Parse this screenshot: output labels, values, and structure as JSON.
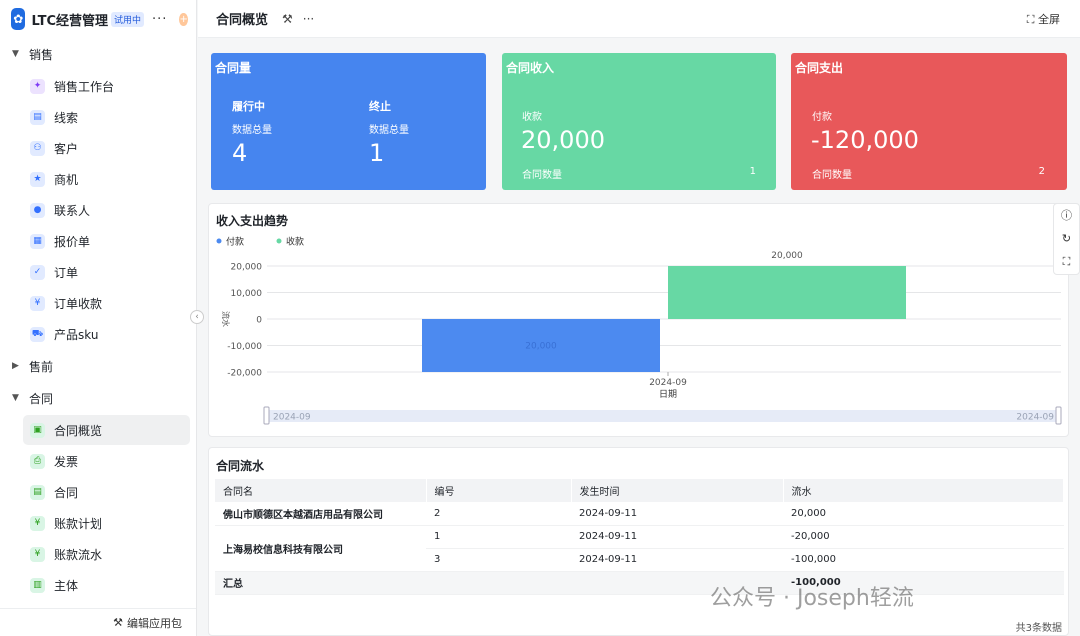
{
  "app": {
    "name": "LTC经营管理",
    "trial_badge": "试用中",
    "more": "···",
    "footer_label": "编辑应用包"
  },
  "sidebar": {
    "groups": [
      {
        "label": "销售",
        "expanded": true
      },
      {
        "label": "售前",
        "expanded": false
      },
      {
        "label": "合同",
        "expanded": true
      }
    ],
    "sales_items": [
      "销售工作台",
      "线索",
      "客户",
      "商机",
      "联系人",
      "报价单",
      "订单",
      "订单收款",
      "产品sku"
    ],
    "contract_items": [
      "合同概览",
      "发票",
      "合同",
      "账款计划",
      "账款流水",
      "主体"
    ],
    "active": "合同概览"
  },
  "topbar": {
    "title": "合同概览",
    "fullscreen": "全屏"
  },
  "cards": {
    "contracts": {
      "title": "合同量",
      "col1_label": "履行中",
      "col1_sub": "数据总量",
      "col1_value": "4",
      "col2_label": "终止",
      "col2_sub": "数据总量",
      "col2_value": "1",
      "color": "#4685ef"
    },
    "income": {
      "title": "合同收入",
      "label": "收款",
      "value": "20,000",
      "count_label": "合同数量",
      "count": "1",
      "color": "#67d8a4"
    },
    "expense": {
      "title": "合同支出",
      "label": "付款",
      "value": "-120,000",
      "count_label": "合同数量",
      "count": "2",
      "color": "#e8585a"
    }
  },
  "chart_panel": {
    "title": "收入支出趋势"
  },
  "chart_data": {
    "type": "bar",
    "categories": [
      "2024-09"
    ],
    "series": [
      {
        "name": "付款",
        "values": [
          -20000
        ],
        "label": "20,000",
        "color": "#4c8af0"
      },
      {
        "name": "收款",
        "values": [
          20000
        ],
        "label": "20,000",
        "color": "#67d8a4"
      }
    ],
    "xlabel": "日期",
    "ylabel": "流水",
    "ylim": [
      -20000,
      20000
    ],
    "yticks": [
      "20,000",
      "10,000",
      "0",
      "-10,000",
      "-20,000"
    ],
    "range_start": "2024-09",
    "range_end": "2024-09"
  },
  "table": {
    "title": "合同流水",
    "headers": [
      "合同名",
      "编号",
      "发生时间",
      "流水"
    ],
    "rows": [
      {
        "name": "佛山市顺德区本越酒店用品有限公司",
        "no": "2",
        "date": "2024-09-11",
        "amount": "20,000"
      },
      {
        "name": "上海易校信息科技有限公司",
        "no": "1",
        "date": "2024-09-11",
        "amount": "-20,000"
      },
      {
        "name": "",
        "no": "3",
        "date": "2024-09-11",
        "amount": "-100,000"
      }
    ],
    "total_label": "汇总",
    "total_value": "-100,000",
    "footer": "共3条数据"
  },
  "watermark": "公众号 · Joseph轻流"
}
